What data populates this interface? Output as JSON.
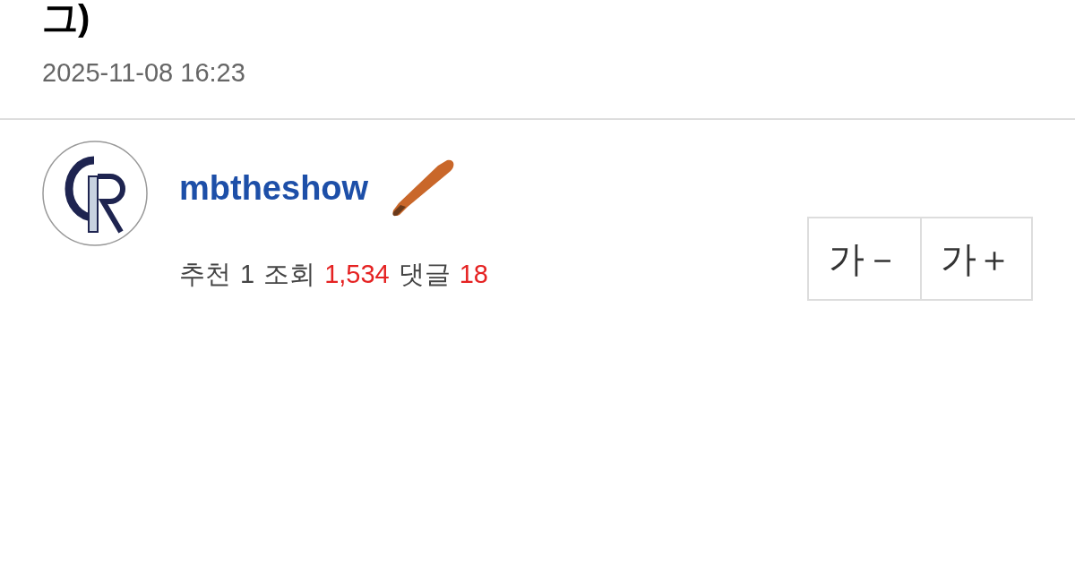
{
  "title": "그)",
  "date": "2025-11-08 16:23",
  "author": {
    "name": "mbtheshow"
  },
  "stats": [
    {
      "label": "추천",
      "value": "1",
      "highlight": false
    },
    {
      "label": "조회",
      "value": "1,534",
      "highlight": true
    },
    {
      "label": "댓글",
      "value": "18",
      "highlight": true
    }
  ],
  "font_buttons": [
    {
      "label": "가－"
    },
    {
      "label": "가＋"
    }
  ]
}
